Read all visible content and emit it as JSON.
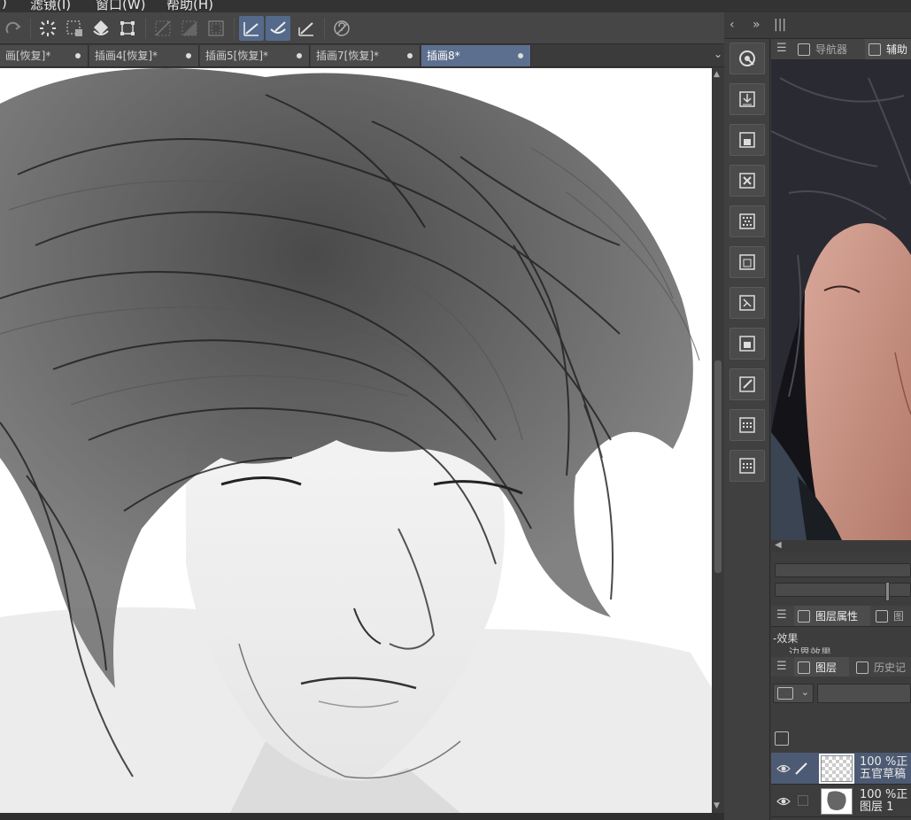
{
  "menu": {
    "items": [
      ")",
      "滤镜(I)",
      "窗口(W)",
      "帮助(H)"
    ]
  },
  "tabs": [
    {
      "label": "画[恢复]*",
      "active": false
    },
    {
      "label": "插画4[恢复]*",
      "active": false
    },
    {
      "label": "插画5[恢复]*",
      "active": false
    },
    {
      "label": "插画7[恢复]*",
      "active": false
    },
    {
      "label": "插画8*",
      "active": true
    }
  ],
  "right_top": {
    "collapse": "‹",
    "expand": "»",
    "grip": "|||"
  },
  "panel_tabs": {
    "top": [
      "导航器",
      "辅助"
    ],
    "properties": [
      "图层属性",
      "图"
    ],
    "layers": [
      "图层",
      "历史记"
    ]
  },
  "effect": {
    "label": "-效果",
    "row": "边界效果"
  },
  "layers": [
    {
      "opacity": "100 %正",
      "name": "五官草稿",
      "selected": true,
      "editing": true
    },
    {
      "opacity": "100 %正",
      "name": "图层 1",
      "selected": false,
      "editing": false
    }
  ],
  "icons": {
    "toolbar": [
      "redo-icon",
      "select-all-icon",
      "deselect-icon",
      "fill-icon",
      "transform-icon",
      "clear-outside-icon",
      "fill-selection-icon",
      "border-icon",
      "ruler-icon",
      "snap-icon",
      "perspective-icon",
      "help-icon"
    ],
    "commands": [
      "zoom-icon",
      "import-icon",
      "save-icon",
      "close-icon",
      "texture-icon",
      "layer-export-icon",
      "crop-icon",
      "frame-icon",
      "edit-icon",
      "grid-icon",
      "grid-icon"
    ]
  },
  "colors": {
    "accent": "#5d6f8e",
    "panel": "#3d3d3d",
    "canvas": "#ffffff"
  }
}
